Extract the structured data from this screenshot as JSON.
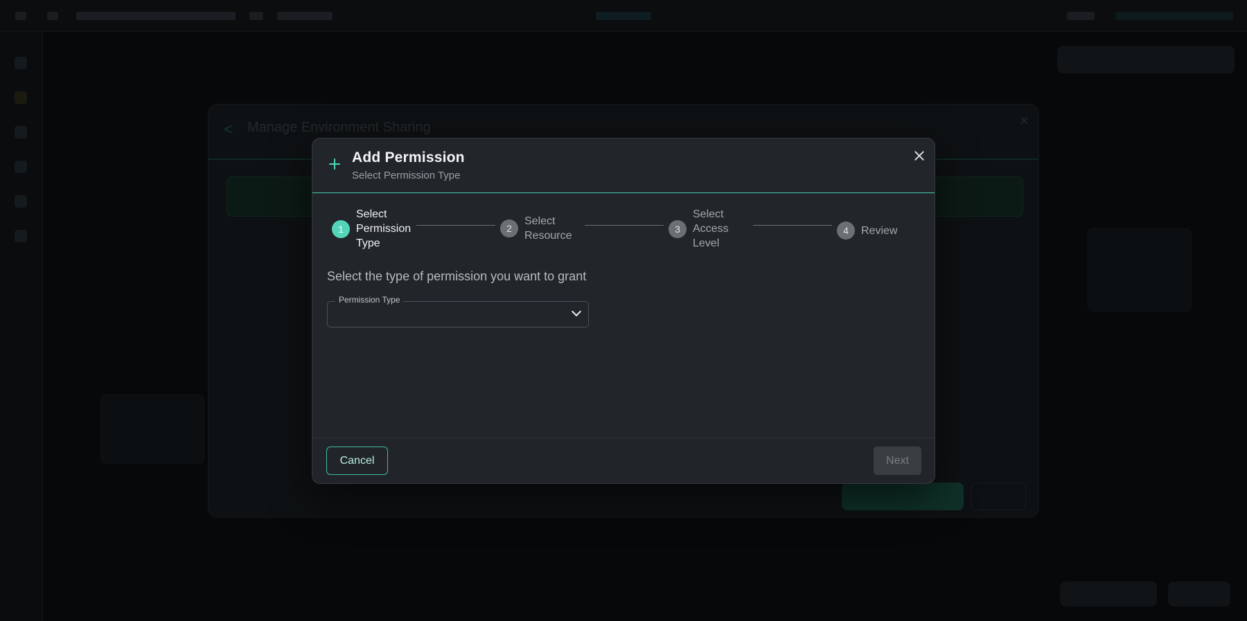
{
  "dialog": {
    "title": "Add Permission",
    "subtitle": "Select Permission Type",
    "prompt": "Select the type of permission you want to grant",
    "steps": [
      {
        "number": "1",
        "label": "Select Permission Type",
        "active": true
      },
      {
        "number": "2",
        "label": "Select Resource",
        "active": false
      },
      {
        "number": "3",
        "label": "Select Access Level",
        "active": false
      },
      {
        "number": "4",
        "label": "Review",
        "active": false
      }
    ],
    "permission_type": {
      "label": "Permission Type",
      "value": ""
    },
    "cancel_label": "Cancel",
    "next_label": "Next"
  },
  "background_modal": {
    "title": "Manage Environment Sharing"
  },
  "colors": {
    "accent": "#53d5ba",
    "dialog_bg": "#22262a",
    "page_bg": "#07080a"
  }
}
